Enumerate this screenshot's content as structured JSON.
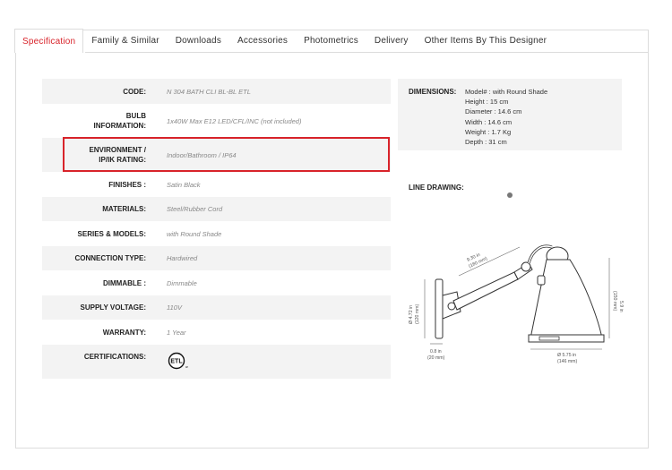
{
  "tabs": [
    {
      "label": "Specification",
      "active": true
    },
    {
      "label": "Family & Similar",
      "active": false
    },
    {
      "label": "Downloads",
      "active": false
    },
    {
      "label": "Accessories",
      "active": false
    },
    {
      "label": "Photometrics",
      "active": false
    },
    {
      "label": "Delivery",
      "active": false
    },
    {
      "label": "Other Items By This Designer",
      "active": false
    }
  ],
  "specs": {
    "code": {
      "label": "CODE:",
      "value": "N 304 BATH CLI BL-BL ETL"
    },
    "bulb": {
      "label1": "BULB",
      "label2": "INFORMATION:",
      "value": "1x40W Max E12 LED/CFL/INC (not included)"
    },
    "environment": {
      "label1": "ENVIRONMENT /",
      "label2": "IP/IK RATING:",
      "value": "Indoor/Bathroom / IP64"
    },
    "finishes": {
      "label": "FINISHES :",
      "value": "Satin Black"
    },
    "materials": {
      "label": "MATERIALS:",
      "value": "Steel/Rubber Cord"
    },
    "series": {
      "label": "SERIES & MODELS:",
      "value": "with Round Shade"
    },
    "connection": {
      "label": "CONNECTION TYPE:",
      "value": "Hardwired"
    },
    "dimmable": {
      "label": "DIMMABLE :",
      "value": "Dimmable"
    },
    "voltage": {
      "label": "SUPPLY VOLTAGE:",
      "value": "110V"
    },
    "warranty": {
      "label": "WARRANTY:",
      "value": "1 Year"
    },
    "certifications": {
      "label": "CERTIFICATIONS:",
      "logo_text": "ETL"
    }
  },
  "dimensions": {
    "label": "DIMENSIONS:",
    "lines": [
      "Model# : with Round Shade",
      "Height : 15 cm",
      "Diameter : 14.6 cm",
      "Width : 14.6 cm",
      "Weight : 1.7 Kg",
      "Depth : 31 cm"
    ]
  },
  "line_drawing": {
    "label": "LINE DRAWING:",
    "annotations": {
      "arm_in": "9.30 in",
      "arm_mm": "(180 mm)",
      "base_h_in": "Ø 4.72 in",
      "base_h_mm": "(120 mm)",
      "depth_in": "0.8 in",
      "depth_mm": "(20 mm)",
      "shade_h_in": "5.9 in",
      "shade_h_mm": "(150 mm)",
      "shade_d_in": "Ø 5.75 in",
      "shade_d_mm": "(146 mm)"
    }
  },
  "colors": {
    "accent": "#d8232a",
    "row_shade": "#f3f3f3"
  }
}
